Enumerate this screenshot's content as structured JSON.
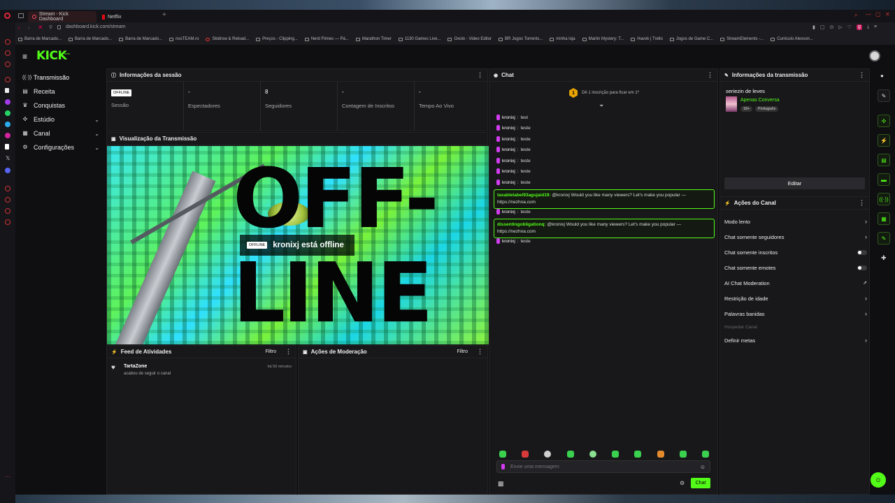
{
  "browser": {
    "tabs": [
      {
        "label": "Stream - Kick Dashboard"
      },
      {
        "label": "Netflix"
      }
    ],
    "address": "dashboard.kick.com/stream",
    "bookmarks": [
      "Barra de Marcado...",
      "Barra de Marcado...",
      "Barra de Marcado...",
      "nosTEAM.ro",
      "Skidrow & Reload...",
      "Preços - Clipping...",
      "Nerd Filmes — Pá...",
      "Marathon Timer",
      "1130 Games Live...",
      "Oxolo - Video Editor",
      "BR Jogos Torrents...",
      "minha loja",
      "Martin Mystery: T...",
      "Havok | Trello",
      "Jogos de Game C...",
      "StreamElements -...",
      "Curriculo Alexson..."
    ]
  },
  "app": {
    "logo": "KICK",
    "logo_badge": "beta",
    "accent": "#53fc18",
    "nav": [
      {
        "label": "Transmissão",
        "icon": "broadcast-icon",
        "active": true
      },
      {
        "label": "Receita",
        "icon": "wallet-icon"
      },
      {
        "label": "Conquistas",
        "icon": "trophy-icon"
      },
      {
        "label": "Estúdio",
        "icon": "studio-icon",
        "expandable": true
      },
      {
        "label": "Canal",
        "icon": "channel-icon",
        "expandable": true
      },
      {
        "label": "Configurações",
        "icon": "gear-icon",
        "expandable": true
      }
    ]
  },
  "session": {
    "title": "Informações da sessão",
    "status_badge": "OFFLINE",
    "stats": [
      {
        "label": "Sessão",
        "value": ""
      },
      {
        "label": "Espectadores",
        "value": "-"
      },
      {
        "label": "Seguidores",
        "value": "8"
      },
      {
        "label": "Contagem de Inscritos",
        "value": "-"
      },
      {
        "label": "Tempo Ao Vivo",
        "value": "-"
      }
    ]
  },
  "preview": {
    "title": "Visualização da Transmissão",
    "badge": "OFFLINE",
    "message": "kronixj está offline",
    "art_text_1": "OFF-",
    "art_text_2": "LINE"
  },
  "activity": {
    "title": "Feed de Atividades",
    "filter": "Filtro",
    "items": [
      {
        "user": "TartaZone",
        "action": "acabou de seguir o canal",
        "time": "há 59 minutos"
      }
    ]
  },
  "moderation": {
    "title": "Ações de Moderação",
    "filter": "Filtro"
  },
  "chat": {
    "title": "Chat",
    "pinned": "Dê 1 inscrição para ficar em 1º",
    "pinned_rank": "1",
    "messages": [
      {
        "user": "kronixj",
        "text": "test"
      },
      {
        "user": "kronixj",
        "text": "teste"
      },
      {
        "user": "kronixj",
        "text": "teste"
      },
      {
        "user": "kronixj",
        "text": "teste"
      },
      {
        "user": "kronixj",
        "text": "teste"
      },
      {
        "user": "kronixj",
        "text": "teste"
      },
      {
        "user": "kronixj",
        "text": "teste"
      }
    ],
    "highlighted": [
      {
        "user": "taxablelabel93agujaid19:",
        "text": "@kronixj Would you like many viewers? Let's make you popular —",
        "link": "https://nezhna.com"
      },
      {
        "user": "dissentingobligationq:",
        "text": "@kronixj Would you like many viewers? Let's make you popular —",
        "link": "https://nezhna.com"
      }
    ],
    "after": [
      {
        "user": "kronixj",
        "text": "teste"
      },
      {
        "user": "kronixj",
        "text": "teste"
      }
    ],
    "input_placeholder": "Envie uma mensagem",
    "send_label": "Chat"
  },
  "stream_info": {
    "title": "Informações da transmissão",
    "stream_title": "seriezin de leves",
    "category": "Apenas Conversa",
    "tag_age": "18+",
    "tag_lang": "Português",
    "edit_label": "Editar"
  },
  "channel_actions": {
    "title": "Ações do Canal",
    "items": [
      {
        "label": "Modo lento",
        "control": "chevron"
      },
      {
        "label": "Chat somente seguidores",
        "control": "chevron"
      },
      {
        "label": "Chat somente inscritos",
        "control": "toggle"
      },
      {
        "label": "Chat somente emotes",
        "control": "toggle"
      },
      {
        "label": "AI Chat Moderation",
        "control": "external"
      },
      {
        "label": "Restrição de idade",
        "control": "chevron"
      },
      {
        "label": "Palavras banidas",
        "control": "chevron"
      },
      {
        "label": "Hospedar Canal",
        "control": "disabled"
      },
      {
        "label": "Definir metas",
        "control": "chevron"
      }
    ]
  }
}
